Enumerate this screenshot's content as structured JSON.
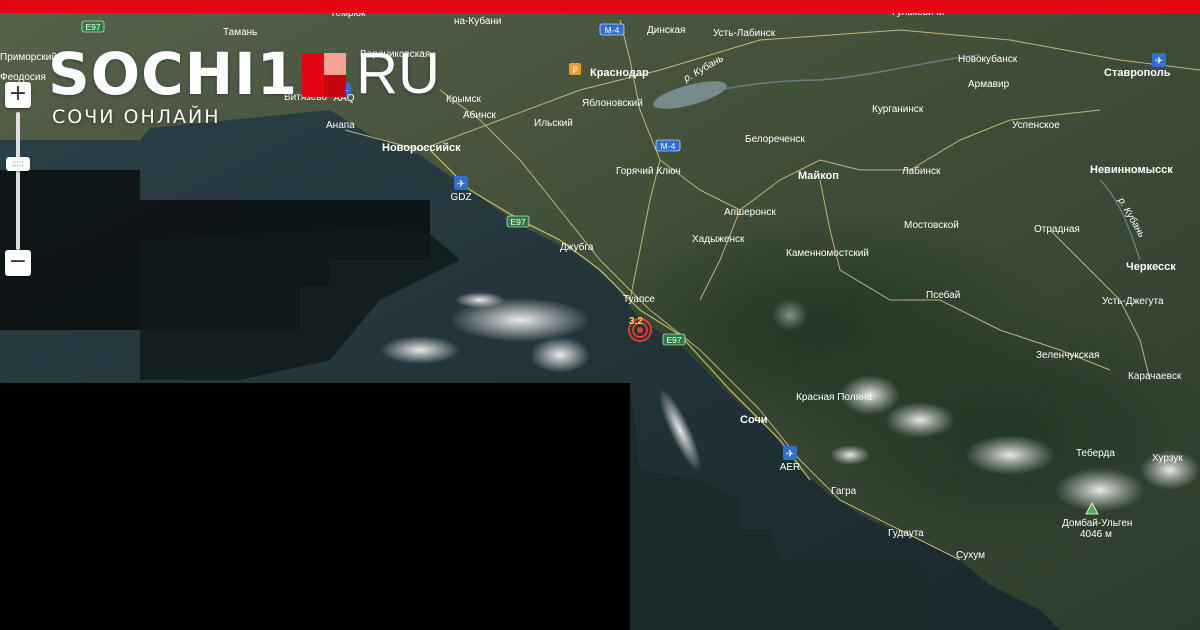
{
  "site": {
    "brand_left": "SOCHI1",
    "brand_right": "RU",
    "tagline": "СОЧИ ОНЛАЙН",
    "mark_colors": [
      "#e30613",
      "#f7a196",
      "#e30613",
      "#c7040f"
    ]
  },
  "zoom": {
    "in_label": "+",
    "out_label": "−",
    "handle_label": ":::::"
  },
  "colors": {
    "top_bar": "#e30613",
    "land": "#3b4a35",
    "sea": "#203034",
    "no_data": "#000000",
    "quake": "#e23b2f"
  },
  "quake": {
    "magnitude": "3.2"
  },
  "places": [
    {
      "id": "temryuk",
      "name": "Темрюк"
    },
    {
      "id": "taman",
      "name": "Тамань"
    },
    {
      "id": "na-kubani",
      "name": "на-Кубани"
    },
    {
      "id": "dinskaya",
      "name": "Динская"
    },
    {
      "id": "ust-labinsk",
      "name": "Усть-Лабинск"
    },
    {
      "id": "gulkevichi",
      "name": "Гулькевичи"
    },
    {
      "id": "primorsky",
      "name": "Приморский"
    },
    {
      "id": "feodosia",
      "name": "Феодосия"
    },
    {
      "id": "varenikovskaya",
      "name": "Варениковская"
    },
    {
      "id": "krasnodar",
      "name": "Краснодар"
    },
    {
      "id": "novokubansk",
      "name": "Новокубанск"
    },
    {
      "id": "armavir",
      "name": "Армавир"
    },
    {
      "id": "stavropol",
      "name": "Ставрополь"
    },
    {
      "id": "vityazevo",
      "name": "Витязево"
    },
    {
      "id": "krymsk",
      "name": "Крымск"
    },
    {
      "id": "yablonovsky",
      "name": "Яблоновский"
    },
    {
      "id": "anapa",
      "name": "Анапа"
    },
    {
      "id": "abinsk",
      "name": "Абинск"
    },
    {
      "id": "ilsky",
      "name": "Ильский"
    },
    {
      "id": "kurganinsk",
      "name": "Курганинск"
    },
    {
      "id": "uspenskoe",
      "name": "Успенское"
    },
    {
      "id": "belorechensk",
      "name": "Белореченск"
    },
    {
      "id": "novorossiysk",
      "name": "Новороссийск"
    },
    {
      "id": "nevinnomyssk",
      "name": "Невинномысск"
    },
    {
      "id": "goryachy-klyuch",
      "name": "Горячий Ключ"
    },
    {
      "id": "maykop",
      "name": "Майкоп"
    },
    {
      "id": "labinsk",
      "name": "Лабинск"
    },
    {
      "id": "apsheronsk",
      "name": "Апшеронск"
    },
    {
      "id": "mostovskoy",
      "name": "Мостовской"
    },
    {
      "id": "otradnaya",
      "name": "Отрадная"
    },
    {
      "id": "dzhubga",
      "name": "Джубга"
    },
    {
      "id": "khadyzhensk",
      "name": "Хадыженск"
    },
    {
      "id": "kamennomostsky",
      "name": "Каменномостский"
    },
    {
      "id": "cherkessk",
      "name": "Черкесск"
    },
    {
      "id": "psebay",
      "name": "Псебай"
    },
    {
      "id": "tuapse",
      "name": "Туапсе"
    },
    {
      "id": "ust-dzheguta",
      "name": "Усть-Джегута"
    },
    {
      "id": "zelenchukskaya",
      "name": "Зеленчукская"
    },
    {
      "id": "karachaevsk",
      "name": "Карачаевск"
    },
    {
      "id": "krasnaya-polyana",
      "name": "Красная Поляна"
    },
    {
      "id": "sochi",
      "name": "Сочи"
    },
    {
      "id": "teberda",
      "name": "Теберда"
    },
    {
      "id": "khurzuk",
      "name": "Хурзук"
    },
    {
      "id": "gagra",
      "name": "Гагра"
    },
    {
      "id": "gudauta",
      "name": "Гудаута"
    },
    {
      "id": "sukhum",
      "name": "Сухум"
    },
    {
      "id": "dombai-ulgen",
      "name": "Домбай-Ульген"
    },
    {
      "id": "dombai-height",
      "name": "4046 м"
    }
  ],
  "roads": [
    {
      "id": "e97-north",
      "code": "E97"
    },
    {
      "id": "m4-north",
      "code": "М-4"
    },
    {
      "id": "m4-south",
      "code": "М-4"
    },
    {
      "id": "e97-dzhubga",
      "code": "E97"
    },
    {
      "id": "e97-tuapse",
      "code": "E97"
    }
  ],
  "rivers": [
    {
      "id": "kuban-west",
      "name": "р. Кубань"
    },
    {
      "id": "kuban-east",
      "name": "р. Кубань"
    }
  ],
  "airports": [
    {
      "id": "aaq",
      "code": "AAQ"
    },
    {
      "id": "gdz",
      "code": "GDZ"
    },
    {
      "id": "aer",
      "code": "AER"
    }
  ]
}
